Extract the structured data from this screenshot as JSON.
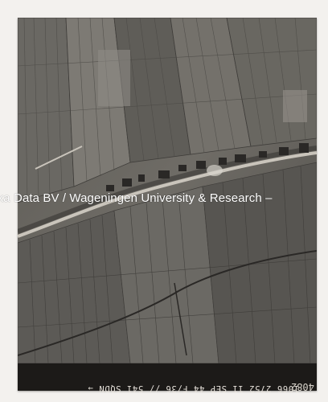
{
  "image": {
    "subject": "aerial-photograph",
    "colors": {
      "paper": "#f3f1ee",
      "film_dark": "#1a1816",
      "field_mid": "#6d6b66",
      "field_light": "#8e8b85",
      "road": "#c9c4bb"
    }
  },
  "watermark": {
    "text": "otka Data BV / Wageningen University & Research –"
  },
  "strip": {
    "caption": "1066 2752 11 SEP 44 F/36 // 541 SQDN →",
    "print_number": "4082"
  }
}
